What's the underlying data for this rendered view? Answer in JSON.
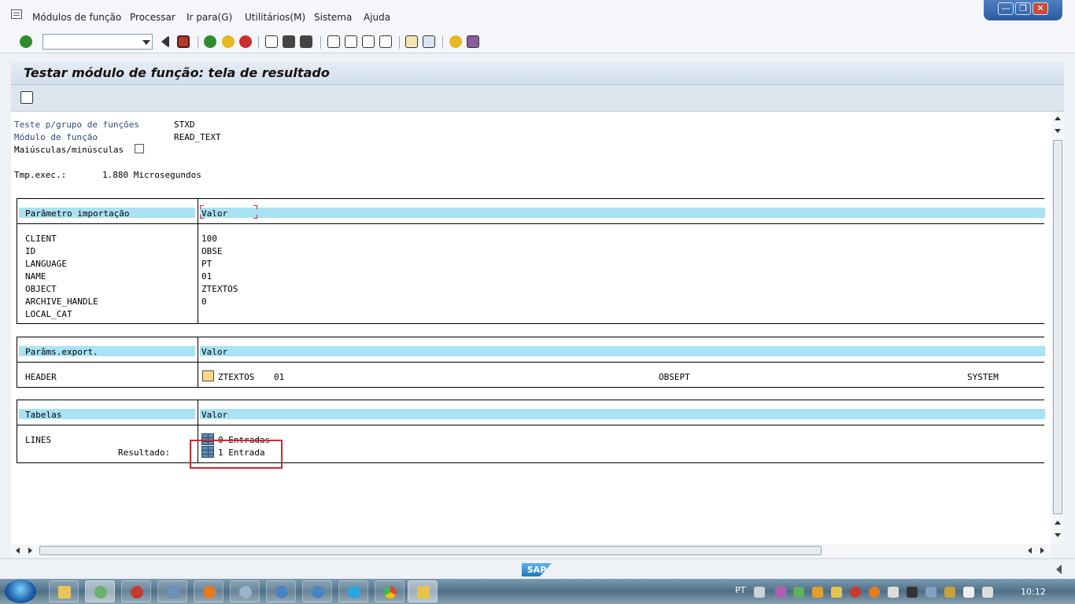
{
  "menu": {
    "items": [
      "Módulos de função",
      "Processar",
      "Ir para(G)",
      "Utilitários(M)",
      "Sistema",
      "Ajuda"
    ]
  },
  "window_controls": {
    "minimize": "—",
    "restore": "❐",
    "close": "✕"
  },
  "toolbar": {
    "command_field_value": "",
    "icons": [
      "enter-icon",
      "back-arrow-icon",
      "save-icon",
      "back-icon",
      "exit-icon",
      "cancel-icon",
      "print-icon",
      "find-icon",
      "find-next-icon",
      "first-page-icon",
      "prev-page-icon",
      "next-page-icon",
      "last-page-icon",
      "new-session-icon",
      "shortcut-icon",
      "help-icon",
      "layout-icon"
    ]
  },
  "title": "Testar módulo de função: tela de resultado",
  "header_info": {
    "test_group_label": "Teste p/grupo de funções",
    "test_group_value": "STXD",
    "function_module_label": "Módulo de função",
    "function_module_value": "READ_TEXT",
    "case_label": "Maiúsculas/minúsculas",
    "case_checked": false,
    "exec_time_label": "Tmp.exec.:",
    "exec_time_value": "1.880 Microsegundos"
  },
  "import_params": {
    "header_param": "Parâmetro importação",
    "header_value": "Valor",
    "rows": [
      {
        "name": "CLIENT",
        "value": "100"
      },
      {
        "name": "ID",
        "value": "OBSE"
      },
      {
        "name": "LANGUAGE",
        "value": "PT"
      },
      {
        "name": "NAME",
        "value": "01"
      },
      {
        "name": "OBJECT",
        "value": "ZTEXTOS"
      },
      {
        "name": "ARCHIVE_HANDLE",
        "value": "0"
      },
      {
        "name": "LOCAL_CAT",
        "value": ""
      }
    ]
  },
  "export_params": {
    "header_param": "Parâms.export.",
    "header_value": "Valor",
    "row": {
      "name": "HEADER",
      "value_1": "ZTEXTOS",
      "value_2": "01",
      "value_3": "OBSEPT",
      "value_4": "SYSTEM"
    }
  },
  "tables": {
    "header_param": "Tabelas",
    "header_value": "Valor",
    "row": {
      "name": "LINES",
      "entries_in": "0 Entradas",
      "result_label": "Resultado:",
      "entries_out": "1 Entrada"
    }
  },
  "statusbar": {
    "logo": "SAP"
  },
  "taskbar": {
    "language": "PT",
    "clock": "10:12"
  },
  "colors": {
    "header_band": "#a9e2f3",
    "highlight_box": "#d3262e",
    "label_blue": "#2b4c78"
  }
}
